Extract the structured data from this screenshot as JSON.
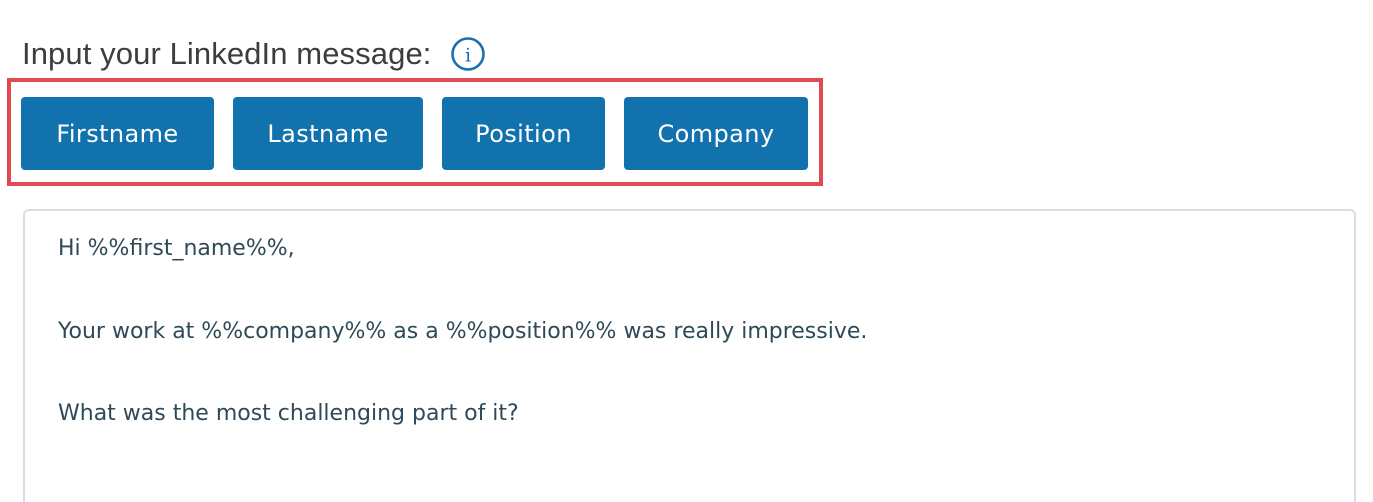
{
  "header": {
    "label": "Input your LinkedIn message:",
    "info_icon": "info-circle-icon",
    "info_symbol": "i"
  },
  "variables": {
    "buttons": [
      {
        "label": "Firstname"
      },
      {
        "label": "Lastname"
      },
      {
        "label": "Position"
      },
      {
        "label": "Company"
      }
    ]
  },
  "message": {
    "lines": [
      "Hi %%first_name%%,",
      "Your work at %%company%% as a %%position%% was really impressive.",
      "What was the most challenging part of it?"
    ]
  },
  "colors": {
    "button_bg": "#1172ae",
    "highlight": "#e04a53",
    "icon": "#1a6fb5"
  }
}
